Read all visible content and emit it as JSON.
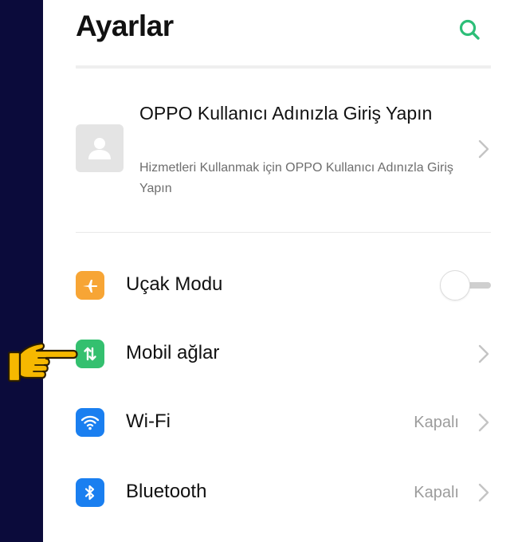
{
  "header": {
    "title": "Ayarlar",
    "search_icon": "search-icon"
  },
  "account": {
    "title": "OPPO Kullanıcı Adınızla Giriş Yapın",
    "subtitle": "Hizmetleri Kullanmak için OPPO Kullanıcı Adınızla Giriş Yapın",
    "icon": "user-avatar-icon"
  },
  "settings": {
    "items": [
      {
        "label": "Uçak Modu",
        "icon": "airplane-icon",
        "icon_color": "#F7A535",
        "toggle": "off"
      },
      {
        "label": "Mobil ağlar",
        "icon": "mobile-data-icon",
        "icon_color": "#34C06F"
      },
      {
        "label": "Wi-Fi",
        "icon": "wifi-icon",
        "icon_color": "#1A7FF0",
        "value": "Kapalı"
      },
      {
        "label": "Bluetooth",
        "icon": "bluetooth-icon",
        "icon_color": "#1A7FF0",
        "value": "Kapalı"
      }
    ]
  },
  "colors": {
    "accent": "#2DBE78",
    "pointer": "#F6B800"
  }
}
